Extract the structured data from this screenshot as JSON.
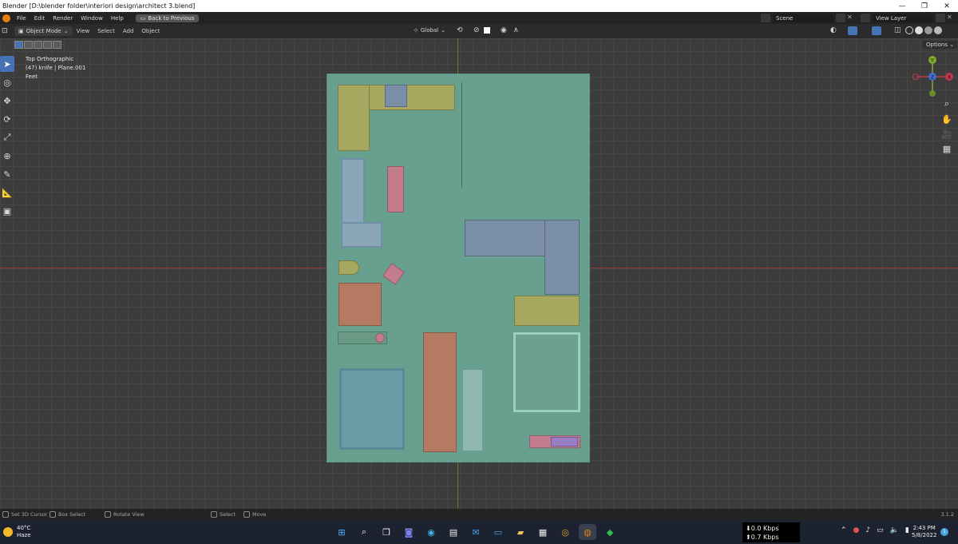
{
  "window": {
    "title": "Blender [D:\\blender folder\\interiori design\\architect 3.blend]",
    "minimize": "—",
    "maximize": "❐",
    "close": "✕"
  },
  "topbar": {
    "menus": [
      "File",
      "Edit",
      "Render",
      "Window",
      "Help"
    ],
    "back_button": "Back to Previous",
    "scene_label": "Scene",
    "view_layer_label": "View Layer"
  },
  "viewport_header": {
    "mode": "Object Mode",
    "menus": [
      "View",
      "Select",
      "Add",
      "Object"
    ],
    "transform_orientation": "Global",
    "options_label": "Options"
  },
  "overlay": {
    "view_name": "Top Orthographic",
    "object_info": "(47) knife | Plane.001",
    "units": "Feet"
  },
  "gizmo": {
    "y": "Y",
    "x": "X",
    "z": "Z"
  },
  "statusbar": {
    "hints": [
      "Set 3D Cursor",
      "Box Select",
      "Rotate View",
      "Select",
      "Move"
    ],
    "version": "3.1.2"
  },
  "taskbar": {
    "temperature": "40°C",
    "weather": "Haze",
    "net_down": "⬇0.0 Kbps",
    "net_up": "⬆0.7 Kbps",
    "time": "2:43 PM",
    "date": "5/8/2022",
    "notifications": "1"
  },
  "colors": {
    "floor": "#67a08e",
    "kitchen_counter": "#a5a85e",
    "sofa_blue": "#7b8ea8",
    "bed_pink": "#c47b8e",
    "table_brown": "#b57a62",
    "selection_blue": "#4772b3"
  }
}
